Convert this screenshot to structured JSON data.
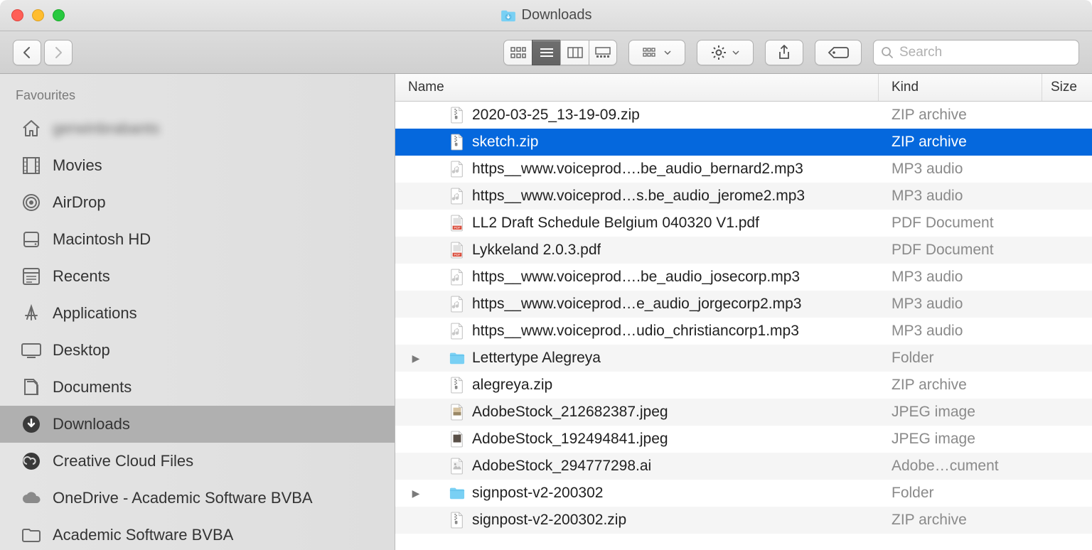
{
  "window": {
    "title": "Downloads"
  },
  "toolbar": {
    "search_placeholder": "Search"
  },
  "sidebar": {
    "header": "Favourites",
    "items": [
      {
        "label": "gerwinbrabants",
        "icon": "home",
        "blurred": true
      },
      {
        "label": "Movies",
        "icon": "film"
      },
      {
        "label": "AirDrop",
        "icon": "airdrop"
      },
      {
        "label": "Macintosh HD",
        "icon": "disk"
      },
      {
        "label": "Recents",
        "icon": "recents"
      },
      {
        "label": "Applications",
        "icon": "apps"
      },
      {
        "label": "Desktop",
        "icon": "desktop"
      },
      {
        "label": "Documents",
        "icon": "documents"
      },
      {
        "label": "Downloads",
        "icon": "downloads",
        "selected": true
      },
      {
        "label": "Creative Cloud Files",
        "icon": "cc"
      },
      {
        "label": "OneDrive - Academic Software BVBA",
        "icon": "cloud"
      },
      {
        "label": "Academic Software BVBA",
        "icon": "folder"
      }
    ]
  },
  "columns": {
    "name": "Name",
    "kind": "Kind",
    "size": "Size"
  },
  "files": [
    {
      "name": "2020-03-25_13-19-09.zip",
      "kind": "ZIP archive",
      "icon": "zip"
    },
    {
      "name": "sketch.zip",
      "kind": "ZIP archive",
      "icon": "zip",
      "selected": true
    },
    {
      "name": "https__www.voiceprod….be_audio_bernard2.mp3",
      "kind": "MP3 audio",
      "icon": "audio"
    },
    {
      "name": "https__www.voiceprod…s.be_audio_jerome2.mp3",
      "kind": "MP3 audio",
      "icon": "audio"
    },
    {
      "name": "LL2 Draft Schedule Belgium 040320 V1.pdf",
      "kind": "PDF Document",
      "icon": "pdf"
    },
    {
      "name": "Lykkeland 2.0.3.pdf",
      "kind": "PDF Document",
      "icon": "pdf"
    },
    {
      "name": "https__www.voiceprod….be_audio_josecorp.mp3",
      "kind": "MP3 audio",
      "icon": "audio"
    },
    {
      "name": "https__www.voiceprod…e_audio_jorgecorp2.mp3",
      "kind": "MP3 audio",
      "icon": "audio"
    },
    {
      "name": "https__www.voiceprod…udio_christiancorp1.mp3",
      "kind": "MP3 audio",
      "icon": "audio"
    },
    {
      "name": "Lettertype Alegreya",
      "kind": "Folder",
      "icon": "folder",
      "expandable": true
    },
    {
      "name": "alegreya.zip",
      "kind": "ZIP archive",
      "icon": "zip"
    },
    {
      "name": "AdobeStock_212682387.jpeg",
      "kind": "JPEG image",
      "icon": "jpeg1"
    },
    {
      "name": "AdobeStock_192494841.jpeg",
      "kind": "JPEG image",
      "icon": "jpeg2"
    },
    {
      "name": "AdobeStock_294777298.ai",
      "kind": "Adobe…cument",
      "icon": "ai"
    },
    {
      "name": "signpost-v2-200302",
      "kind": "Folder",
      "icon": "folder",
      "expandable": true
    },
    {
      "name": "signpost-v2-200302.zip",
      "kind": "ZIP archive",
      "icon": "zip"
    }
  ]
}
